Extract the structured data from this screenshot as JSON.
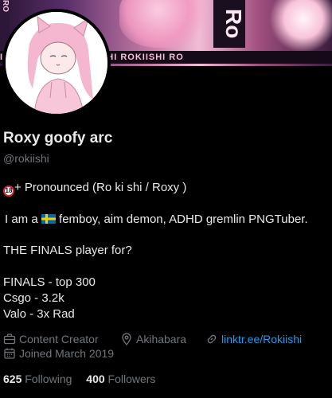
{
  "banner": {
    "strip_text": "ISHI ROKIISHI ROKIISHI ROKIISHI RO",
    "big_letters": "Ro",
    "side_letters": "RO"
  },
  "profile": {
    "display_name": "Roxy goofy arc",
    "handle": "@rokiishi"
  },
  "bio": {
    "line1_badge": "18",
    "line1_text": "+ Pronounced (Ro ki shi / Roxy )",
    "line2_prefix": "I am a ",
    "line2_suffix": " femboy, aim demon, ADHD gremlin PNGTuber.",
    "line3": "THE FINALS player for?",
    "line4": "FINALS - top 300",
    "line5": "Csgo - 3.2k",
    "line6": "Valo - 3x Rad"
  },
  "meta": {
    "category": "Content Creator",
    "location": "Akihabara",
    "link": "linktr.ee/Rokiishi",
    "joined": "Joined March 2019"
  },
  "stats": {
    "following_count": "625",
    "following_label": "Following",
    "followers_count": "400",
    "followers_label": "Followers"
  },
  "colors": {
    "background": "#000000",
    "text": "#e7e9ea",
    "muted": "#71767b",
    "link": "#1d9bf0"
  },
  "icons": {
    "category": "briefcase-icon",
    "location": "location-pin-icon",
    "link": "link-icon",
    "joined": "calendar-icon"
  }
}
